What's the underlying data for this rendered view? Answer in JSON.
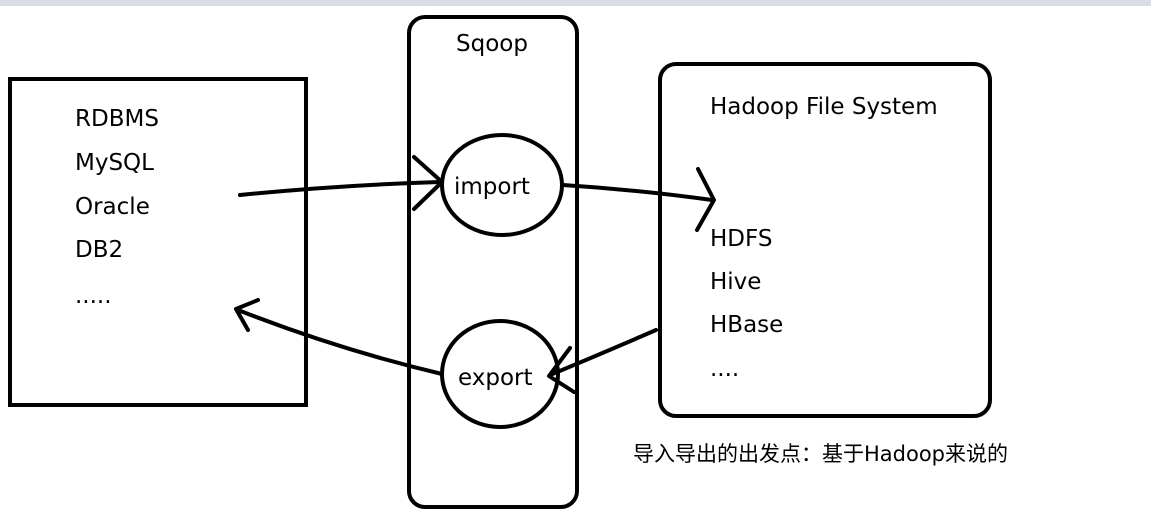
{
  "sources": {
    "items": [
      "RDBMS",
      "MySQL",
      "Oracle",
      "DB2",
      "....."
    ]
  },
  "sqoop": {
    "title": "Sqoop",
    "import_label": "import",
    "export_label": "export"
  },
  "hadoop": {
    "title": "Hadoop File System",
    "items": [
      "HDFS",
      "Hive",
      "HBase",
      "...."
    ]
  },
  "note": "导入导出的出发点：基于Hadoop来说的"
}
